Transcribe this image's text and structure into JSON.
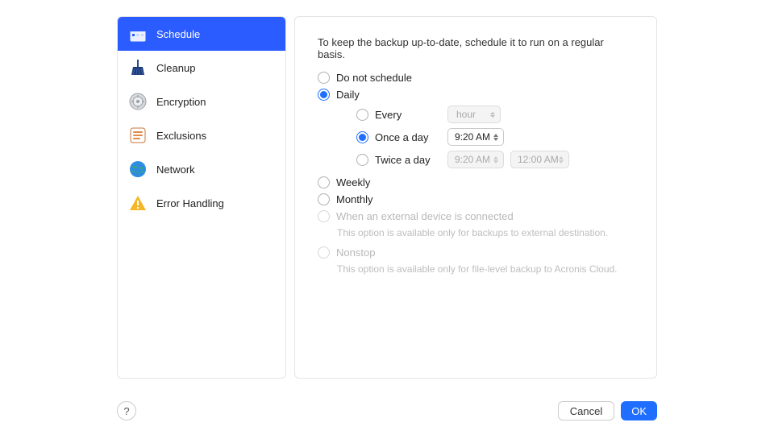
{
  "sidebar": {
    "items": [
      {
        "label": "Schedule"
      },
      {
        "label": "Cleanup"
      },
      {
        "label": "Encryption"
      },
      {
        "label": "Exclusions"
      },
      {
        "label": "Network"
      },
      {
        "label": "Error Handling"
      }
    ]
  },
  "content": {
    "intro": "To keep the backup up-to-date, schedule it to run on a regular basis.",
    "options": {
      "do_not_schedule": "Do not schedule",
      "daily": "Daily",
      "weekly": "Weekly",
      "monthly": "Monthly",
      "external": "When an external device is connected",
      "external_hint": "This option is available only for backups to external destination.",
      "nonstop": "Nonstop",
      "nonstop_hint": "This option is available only for file-level backup to Acronis Cloud."
    },
    "daily": {
      "every": "Every",
      "every_unit": "hour",
      "once_a_day": "Once a day",
      "once_time": "9:20 AM",
      "twice_a_day": "Twice a day",
      "twice_time1": "9:20 AM",
      "twice_time2": "12:00 AM"
    }
  },
  "footer": {
    "help": "?",
    "cancel": "Cancel",
    "ok": "OK"
  }
}
